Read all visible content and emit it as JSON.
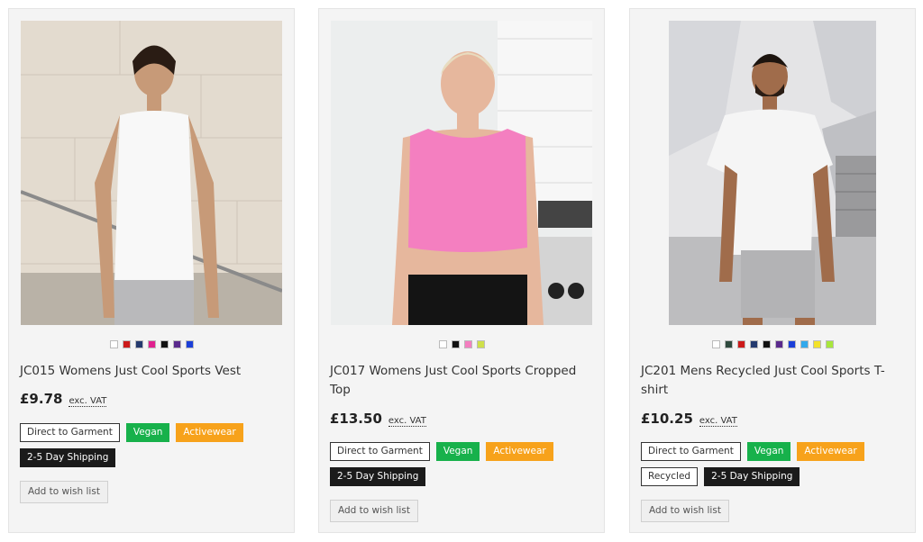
{
  "products": [
    {
      "title": "JC015 Womens Just Cool Sports Vest",
      "price": "£9.78",
      "vat_label": "exc. VAT",
      "swatches": [
        "#ffffff",
        "#cc1a1a",
        "#243a6e",
        "#e0228f",
        "#111111",
        "#5a2a8c",
        "#1b3fd8"
      ],
      "tags": [
        "Direct to Garment",
        "Vegan",
        "Activewear",
        "2-5 Day Shipping"
      ],
      "wishlist_label": "Add to wish list"
    },
    {
      "title": "JC017 Womens Just Cool Sports Cropped Top",
      "price": "£13.50",
      "vat_label": "exc. VAT",
      "swatches": [
        "#ffffff",
        "#111111",
        "#f47fc0",
        "#cfe04a"
      ],
      "tags": [
        "Direct to Garment",
        "Vegan",
        "Activewear",
        "2-5 Day Shipping"
      ],
      "wishlist_label": "Add to wish list"
    },
    {
      "title": "JC201 Mens Recycled Just Cool Sports T-shirt",
      "price": "£10.25",
      "vat_label": "exc. VAT",
      "swatches": [
        "#ffffff",
        "#2f4a3e",
        "#cc1a1a",
        "#243a6e",
        "#111111",
        "#5a2a8c",
        "#1b3fd8",
        "#33a9ec",
        "#f3e22a",
        "#a8e63c"
      ],
      "tags": [
        "Direct to Garment",
        "Vegan",
        "Activewear",
        "Recycled",
        "2-5 Day Shipping"
      ],
      "wishlist_label": "Add to wish list"
    }
  ],
  "tag_colors": {
    "outline": "#333333",
    "green": "#17b14b",
    "orange": "#f7a21b",
    "black": "#1b1b1b"
  }
}
